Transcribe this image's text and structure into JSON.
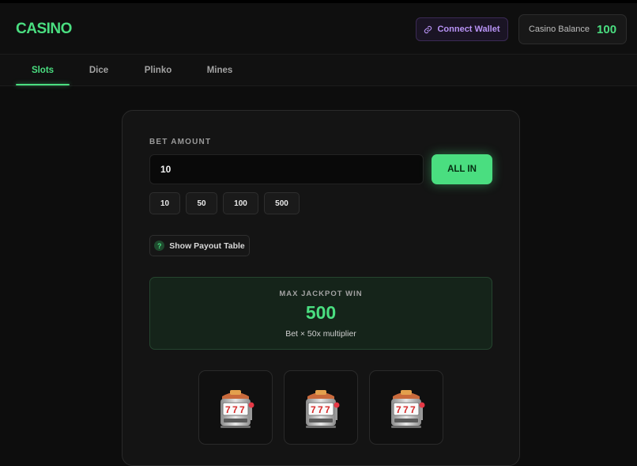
{
  "header": {
    "logo": "CASINO",
    "connect_wallet": "Connect Wallet",
    "balance_label": "Casino Balance",
    "balance_value": "100",
    "wallet_icon": "link-icon"
  },
  "tabs": [
    {
      "label": "Slots",
      "active": true
    },
    {
      "label": "Dice",
      "active": false
    },
    {
      "label": "Plinko",
      "active": false
    },
    {
      "label": "Mines",
      "active": false
    }
  ],
  "bet": {
    "label": "BET AMOUNT",
    "value": "10",
    "all_in": "ALL IN",
    "quick_amounts": [
      "10",
      "50",
      "100",
      "500"
    ]
  },
  "payout": {
    "label": "Show Payout Table",
    "icon": "?"
  },
  "jackpot": {
    "title": "MAX JACKPOT WIN",
    "value": "500",
    "subtitle": "Bet × 50x multiplier"
  },
  "reels": [
    {
      "icon": "slot-machine-icon"
    },
    {
      "icon": "slot-machine-icon"
    },
    {
      "icon": "slot-machine-icon"
    }
  ],
  "colors": {
    "accent": "#4ade80",
    "wallet": "#b893f5",
    "background": "#0d0d0d"
  }
}
